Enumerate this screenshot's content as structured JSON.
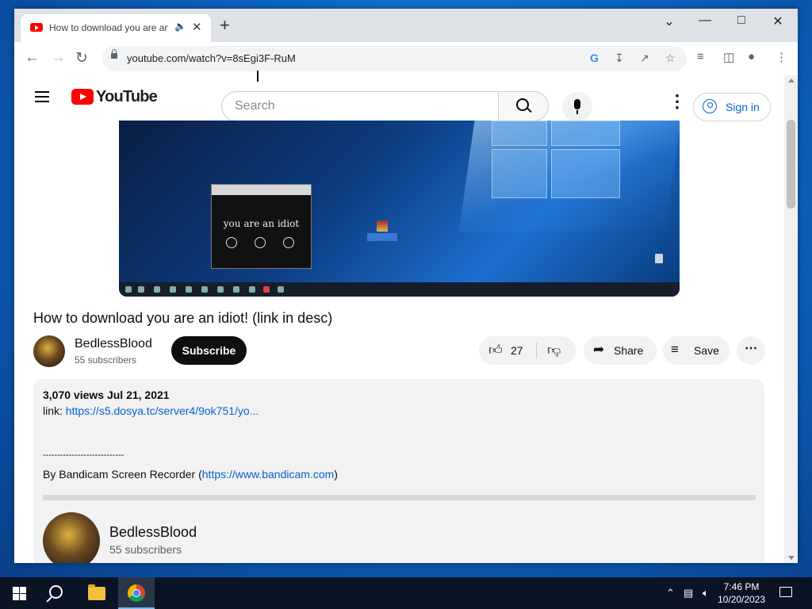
{
  "browser": {
    "tab_title": "How to download you are an idiot! (link in desc) - YouTube",
    "url": "youtube.com/watch?v=8sEgi3F-RuM",
    "new_tab_symbol": "+",
    "window_controls": {
      "minimize": "—",
      "maximize": "□",
      "close": "✕",
      "tab_search": "⌄"
    }
  },
  "youtube": {
    "logo_text": "YouTube",
    "search_placeholder": "Search",
    "sign_in": "Sign in",
    "video": {
      "inner_window_text": "you are an idiot",
      "title": "How to download you are an idiot! (link in desc)"
    },
    "channel": {
      "name": "BedlessBlood",
      "subscribers": "55 subscribers"
    },
    "subscribe_label": "Subscribe",
    "actions": {
      "likes": "27",
      "share": "Share",
      "save": "Save"
    },
    "description": {
      "views_date": "3,070 views  Jul 21, 2021",
      "link_prefix": "link: ",
      "link_url": "https://s5.dosya.tc/server4/9ok751/yo...",
      "separator": "----------------------------",
      "recorder_prefix": "By Bandicam Screen Recorder (",
      "recorder_url": "https://www.bandicam.com",
      "recorder_suffix": ")"
    }
  },
  "taskbar": {
    "time": "7:46 PM",
    "date": "10/20/2023"
  },
  "colors": {
    "youtube_red": "#ff0000",
    "link_blue": "#065fd4",
    "chrome_tab_bg": "#dee1e6"
  }
}
